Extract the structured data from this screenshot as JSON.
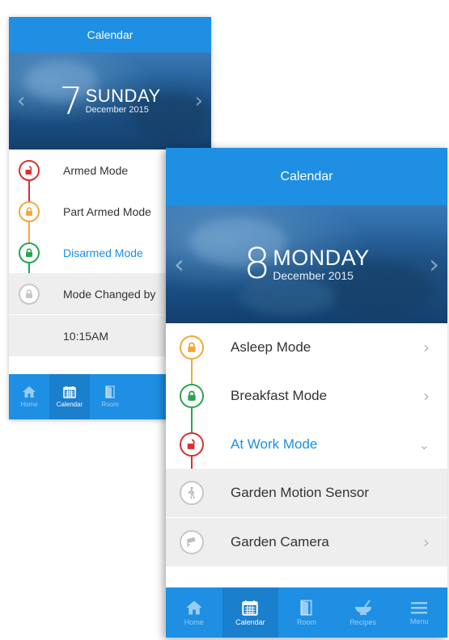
{
  "back_screen": {
    "title": "Calendar",
    "day_number": "7",
    "day_name": "SUNDAY",
    "month_year": "December 2015",
    "items": [
      {
        "label": "Armed Mode",
        "color": "#d9302f",
        "icon": "lock-open-icon"
      },
      {
        "label": "Part Armed Mode",
        "color": "#f0a93a",
        "icon": "lock-icon"
      },
      {
        "label": "Disarmed Mode",
        "color": "#2aa44f",
        "icon": "lock-icon",
        "active": true
      },
      {
        "label": "Mode Changed by",
        "color": "#c8c8c8",
        "icon": "lock-icon"
      }
    ],
    "time_label": "10:15AM",
    "tabs": [
      {
        "label": "Home",
        "icon": "home-icon"
      },
      {
        "label": "Calendar",
        "icon": "calendar-icon",
        "active": true
      },
      {
        "label": "Room",
        "icon": "door-icon"
      }
    ]
  },
  "front_screen": {
    "title": "Calendar",
    "day_number": "8",
    "day_name": "MONDAY",
    "month_year": "December 2015",
    "items": [
      {
        "label": "Asleep Mode",
        "color": "#f0a93a",
        "icon": "lock-icon",
        "chevron": "right"
      },
      {
        "label": "Breakfast Mode",
        "color": "#2aa44f",
        "icon": "lock-icon",
        "chevron": "right"
      },
      {
        "label": "At Work Mode",
        "color": "#d9302f",
        "icon": "lock-open-icon",
        "chevron": "down",
        "active": true
      },
      {
        "label": "Garden Motion Sensor",
        "color": "#c8c8c8",
        "icon": "person-walking-icon"
      },
      {
        "label": "Garden Camera",
        "color": "#c8c8c8",
        "icon": "camera-icon",
        "chevron": "right"
      }
    ],
    "tabs": [
      {
        "label": "Home",
        "icon": "home-icon"
      },
      {
        "label": "Calendar",
        "icon": "calendar-icon",
        "active": true
      },
      {
        "label": "Room",
        "icon": "door-icon"
      },
      {
        "label": "Recipes",
        "icon": "bowl-icon"
      },
      {
        "label": "Menu",
        "icon": "menu-icon"
      }
    ]
  },
  "colors": {
    "accent": "#1e8fe3",
    "tab_active": "#1a7fcc",
    "armed": "#d9302f",
    "part_armed": "#f0a93a",
    "disarmed": "#2aa44f",
    "neutral": "#c8c8c8"
  }
}
